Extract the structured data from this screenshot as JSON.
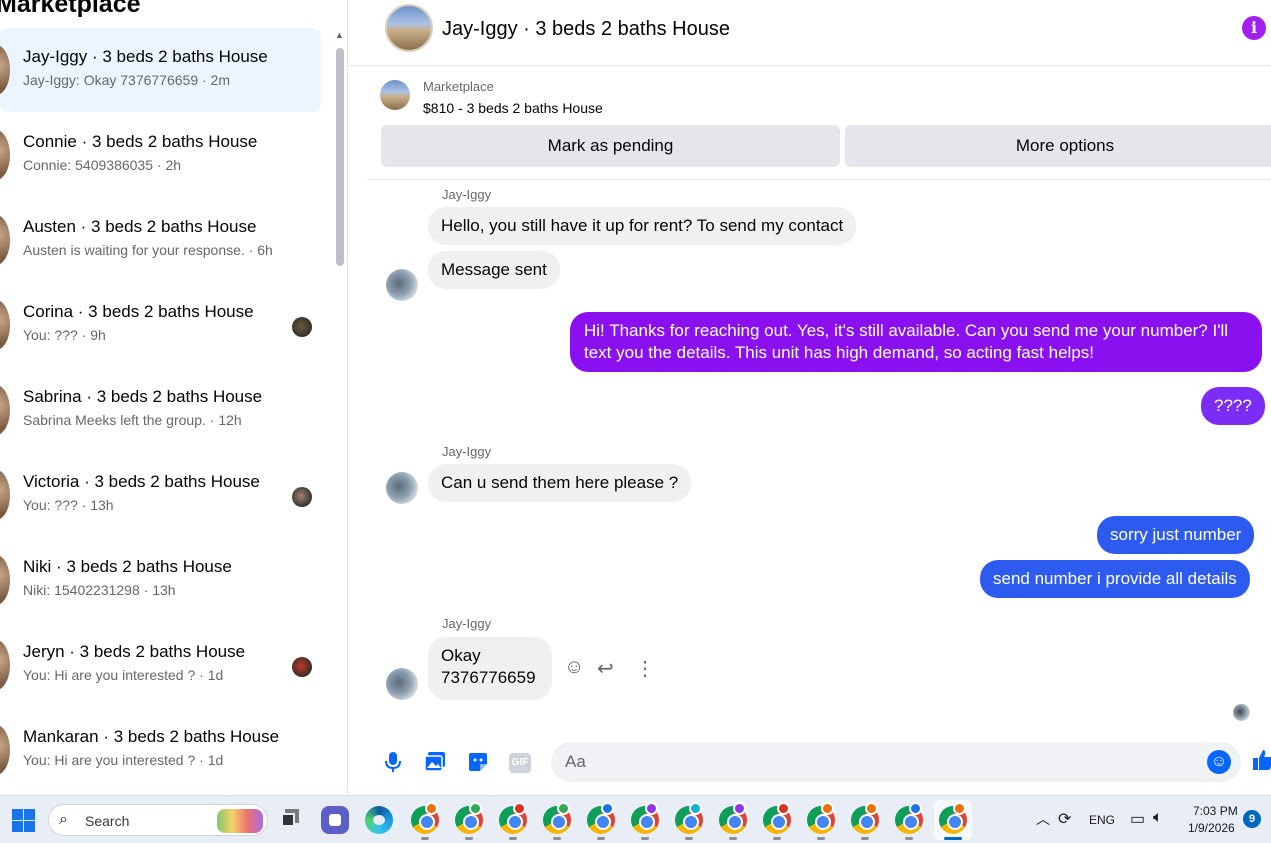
{
  "sidebar": {
    "title": "Marketplace",
    "conversations": [
      {
        "name": "Jay-Iggy · 3 beds 2 baths House",
        "preview": "Jay-Iggy: Okay 7376776659 · 2m",
        "thumb": ""
      },
      {
        "name": "Connie · 3 beds 2 baths House",
        "preview": "Connie: 5409386035 · 2h",
        "thumb": ""
      },
      {
        "name": "Austen · 3 beds 2 baths House",
        "preview": "Austen is waiting for your response. · 6h",
        "thumb": ""
      },
      {
        "name": "Corina · 3 beds 2 baths House",
        "preview": "You: ??? · 9h",
        "thumb": "#6b5a3a"
      },
      {
        "name": "Sabrina · 3 beds 2 baths House",
        "preview": "Sabrina Meeks left the group. · 12h",
        "thumb": ""
      },
      {
        "name": "Victoria · 3 beds 2 baths House",
        "preview": "You: ??? · 13h",
        "thumb": "#a08070"
      },
      {
        "name": "Niki · 3 beds 2 baths House",
        "preview": "Niki: 15402231298 · 13h",
        "thumb": ""
      },
      {
        "name": "Jeryn · 3 beds 2 baths House",
        "preview": "You: Hi are you interested ? · 1d",
        "thumb": "#c0392b"
      },
      {
        "name": "Mankaran · 3 beds 2 baths House",
        "preview": "You: Hi are you interested ? · 1d",
        "thumb": ""
      }
    ]
  },
  "chat": {
    "title": "Jay-Iggy · 3 beds 2 baths House",
    "info_icon": "i",
    "listing": {
      "source": "Marketplace",
      "title": "$810 - 3 beds 2 baths House",
      "pending_label": "Mark as pending",
      "more_label": "More options"
    },
    "messages": {
      "sender": "Jay-Iggy",
      "m1": "Hello, you still have it up for rent? To send my contact",
      "m2": "Message sent",
      "m3": "Hi! Thanks for reaching out. Yes, it's still available. Can you send me your number? I'll text you the details. This unit has high demand, so acting fast helps!",
      "m4": "????",
      "m5": "Can u send them here please ?",
      "m6": "sorry just number",
      "m7": "send number i provide all details",
      "m8_line1": "Okay",
      "m8_line2": "7376776659"
    },
    "composer": {
      "placeholder": "Aa",
      "gif_label": "GIF"
    }
  },
  "taskbar": {
    "search_label": "Search",
    "language": "ENG",
    "time": "7:03 PM",
    "date": "1/9/2026",
    "notification_count": "9",
    "chrome_badges": [
      "#e8710a",
      "#34a853",
      "#d93025",
      "#34a853",
      "#1a73e8",
      "#9334e6",
      "#12b5cb",
      "#9334e6",
      "#d93025",
      "#e8710a",
      "#e8710a",
      "#1a73e8",
      "#e8710a",
      "#d93025"
    ]
  },
  "colors": {
    "active_conversation": "#ebf5ff",
    "purple_bubble": "#8a10f0",
    "blue_bubble": "#2d5bf0",
    "accent": "#0866ff"
  }
}
